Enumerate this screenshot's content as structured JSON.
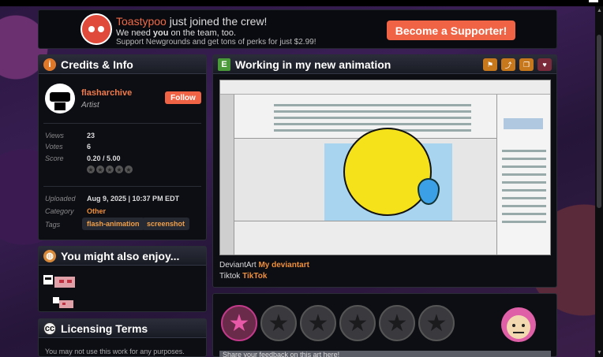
{
  "banner": {
    "username": "Toastypoo",
    "joined": " just joined the crew!",
    "line2_a": "We need ",
    "line2_b": "you",
    "line2_c": " on the team, too.",
    "line3": "Support Newgrounds and get tons of perks for just $2.99!",
    "button": "Become a Supporter!"
  },
  "credits": {
    "title": "Credits & Info",
    "author": "flasharchive",
    "role": "Artist",
    "follow": "Follow",
    "views_label": "Views",
    "views": "23",
    "votes_label": "Votes",
    "votes": "6",
    "score_label": "Score",
    "score": "0.20 / 5.00",
    "uploaded_label": "Uploaded",
    "uploaded": "Aug 9, 2025  |  10:37 PM EDT",
    "category_label": "Category",
    "category": "Other",
    "tags_label": "Tags",
    "tags": [
      "flash-animation",
      "screenshot"
    ]
  },
  "enjoy": {
    "title": "You might also enjoy..."
  },
  "licensing": {
    "title": "Licensing Terms",
    "text": "You may not use this work for any purposes."
  },
  "main": {
    "title": "Working in my new animation",
    "deviantart_label": "DeviantArt",
    "deviantart_link": "My deviantart",
    "tiktok_label": "Tiktok",
    "tiktok_link": "TikTok"
  },
  "review": {
    "feedback_placeholder": "Share your feedback on this art here!"
  },
  "icons": [
    "info-icon",
    "art-icon",
    "palette-icon",
    "cc-icon",
    "flag-icon",
    "share-icon",
    "favorite-icon",
    "heart-icon",
    "star-icon"
  ],
  "colors": {
    "accent": "#f06344",
    "link": "#f0903a",
    "panel": "#0d0e14"
  }
}
